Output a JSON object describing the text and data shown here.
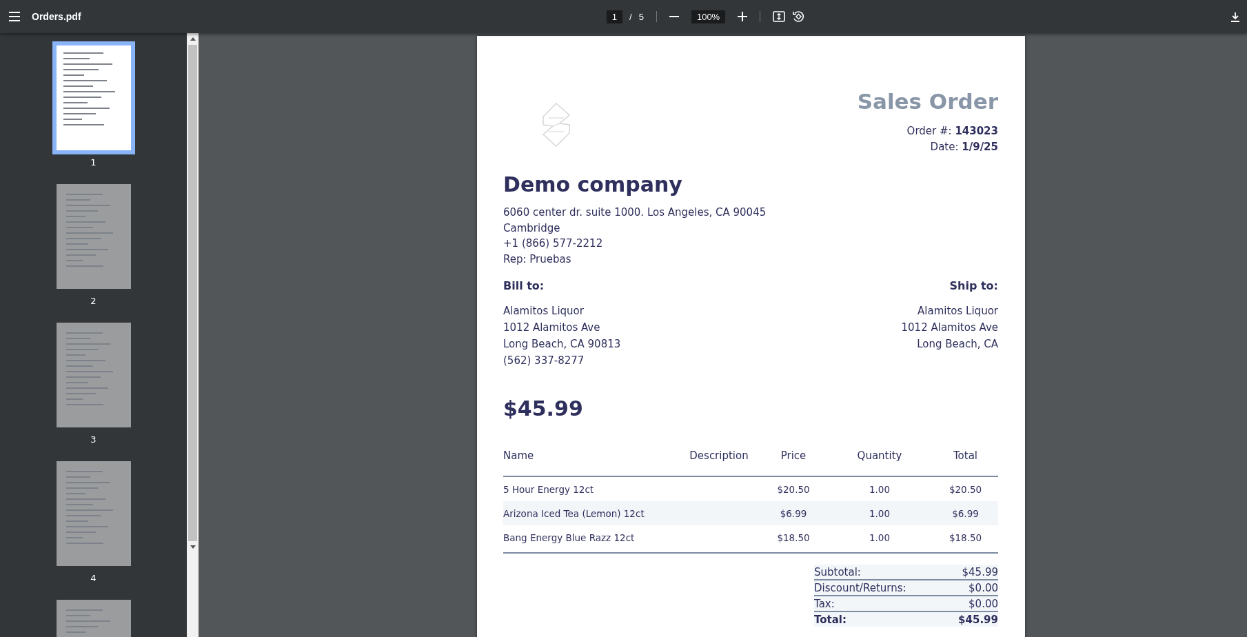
{
  "toolbar": {
    "title": "Orders.pdf",
    "page_input": "1",
    "page_separator": "/",
    "page_count": "5",
    "zoom": "100%"
  },
  "thumbnails": [
    {
      "label": "1",
      "selected": true
    },
    {
      "label": "2",
      "selected": false
    },
    {
      "label": "3",
      "selected": false
    },
    {
      "label": "4",
      "selected": false
    },
    {
      "selected": false
    }
  ],
  "document": {
    "title": "Sales Order",
    "meta": [
      {
        "label": "Order #:",
        "value": "143023"
      },
      {
        "label": "Date:",
        "value": "1/9/25"
      }
    ],
    "company": "Demo company",
    "company_lines": [
      "6060 center dr. suite 1000. Los Angeles, CA 90045",
      "Cambridge",
      "+1 (866) 577-2212",
      "Rep: Pruebas"
    ],
    "bill_to": {
      "heading": "Bill to:",
      "lines": [
        "Alamitos Liquor",
        "1012 Alamitos Ave",
        "Long Beach, CA 90813",
        "(562) 337-8277"
      ]
    },
    "ship_to": {
      "heading": "Ship to:",
      "lines": [
        "Alamitos Liquor",
        "1012 Alamitos Ave",
        "Long Beach, CA"
      ]
    },
    "amount": "$45.99",
    "table": {
      "columns": [
        "Name",
        "Description",
        "Price",
        "Quantity",
        "Total"
      ],
      "rows": [
        {
          "cells": [
            "5 Hour Energy 12ct",
            "",
            "$20.50",
            "1.00",
            "$20.50"
          ]
        },
        {
          "cells": [
            "Arizona Iced Tea (Lemon) 12ct",
            "",
            "$6.99",
            "1.00",
            "$6.99"
          ]
        },
        {
          "cells": [
            "Bang Energy Blue Razz 12ct",
            "",
            "$18.50",
            "1.00",
            "$18.50"
          ]
        }
      ]
    },
    "totals": [
      {
        "label": "Subtotal:",
        "value": "$45.99",
        "bold": false
      },
      {
        "label": "Discount/Returns:",
        "value": "$0.00",
        "bold": false
      },
      {
        "label": "Tax:",
        "value": "$0.00",
        "bold": false
      },
      {
        "label": "Total:",
        "value": "$45.99",
        "bold": true
      }
    ]
  }
}
